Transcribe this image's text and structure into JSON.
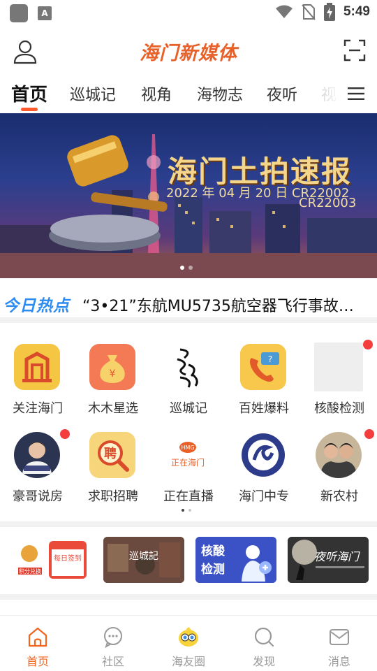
{
  "status_bar": {
    "time": "5:49",
    "notification_letter": "A"
  },
  "header": {
    "logo_text": "海门新媒体"
  },
  "tabs": [
    {
      "label": "首页",
      "active": true
    },
    {
      "label": "巡城记"
    },
    {
      "label": "视角"
    },
    {
      "label": "海物志"
    },
    {
      "label": "夜听"
    },
    {
      "label": "视"
    }
  ],
  "banner": {
    "title": "海门土拍速报",
    "date_line": "2022 年 04 月 20 日  CR22002",
    "code_line": "CR22003",
    "page_count": 2,
    "current_page": 1
  },
  "hot_news": {
    "label": "今日热点",
    "headline": "“3•21”东航MU5735航空器飞行事故…"
  },
  "shortcuts": [
    {
      "label": "关注海门",
      "icon": "building-icon",
      "badge": false
    },
    {
      "label": "木木星选",
      "icon": "money-bag-icon",
      "badge": false
    },
    {
      "label": "巡城记",
      "icon": "calligraphy-logo-icon",
      "badge": false
    },
    {
      "label": "百姓爆料",
      "icon": "phone-chat-icon",
      "badge": false
    },
    {
      "label": "核酸检测",
      "icon": "placeholder-icon",
      "badge": true
    },
    {
      "label": "豪哥说房",
      "icon": "avatar-icon",
      "badge": true
    },
    {
      "label": "求职招聘",
      "icon": "recruit-magnifier-icon",
      "badge": false
    },
    {
      "label": "正在直播",
      "icon": "live-logo-icon",
      "badge": false
    },
    {
      "label": "海门中专",
      "icon": "school-emblem-icon",
      "badge": false
    },
    {
      "label": "新农村",
      "icon": "people-photo-icon",
      "badge": true
    }
  ],
  "shortcut_pages": 2,
  "promo_cards": [
    {
      "name": "points-exchange",
      "text_a": "积分兑换",
      "text_b": "每日签到"
    },
    {
      "name": "xuncheng-ji",
      "text_a": "巡城記"
    },
    {
      "name": "nucleic-test",
      "text_a": "核酸",
      "text_b": "检测"
    },
    {
      "name": "night-listen",
      "text_a": "夜听海门"
    }
  ],
  "bottom_nav": [
    {
      "label": "首页",
      "icon": "home-icon",
      "active": true
    },
    {
      "label": "社区",
      "icon": "chat-bubble-icon"
    },
    {
      "label": "海友圈",
      "icon": "mascot-icon"
    },
    {
      "label": "发现",
      "icon": "discover-icon"
    },
    {
      "label": "消息",
      "icon": "mail-icon"
    }
  ],
  "colors": {
    "accent": "#f0651e",
    "hot_blue": "#2d8cf0",
    "badge_red": "#f43e3e"
  }
}
